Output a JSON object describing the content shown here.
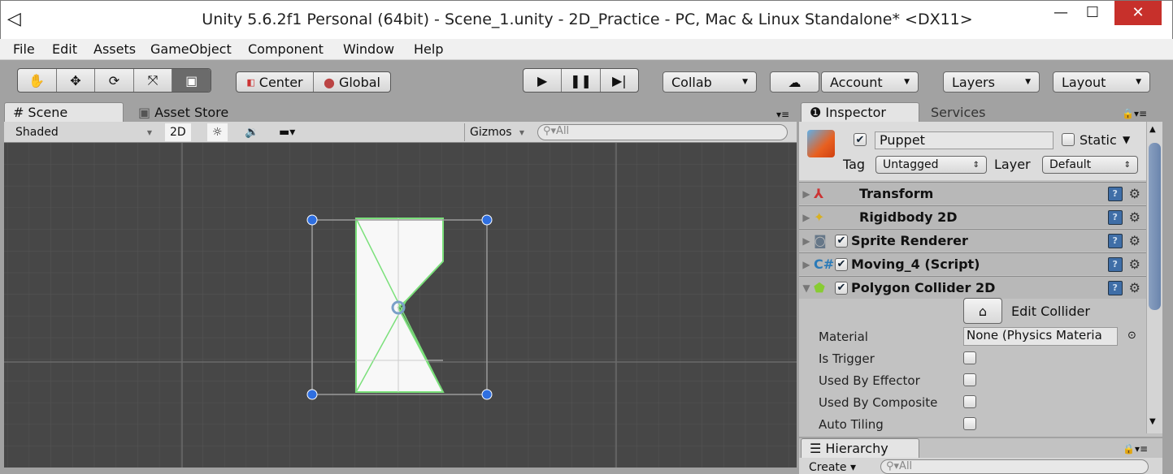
{
  "window": {
    "title": "Unity 5.6.2f1 Personal (64bit) - Scene_1.unity - 2D_Practice - PC, Mac & Linux Standalone* <DX11>",
    "minimize": "—",
    "maximize": "☐",
    "close": "✕"
  },
  "menu": [
    "File",
    "Edit",
    "Assets",
    "GameObject",
    "Component",
    "Window",
    "Help"
  ],
  "toolbar": {
    "center": "Center",
    "global": "Global",
    "collab": "Collab",
    "account": "Account",
    "layers": "Layers",
    "layout": "Layout"
  },
  "tabs": {
    "scene": "Scene",
    "asset_store": "Asset Store",
    "inspector": "Inspector",
    "services": "Services",
    "hierarchy": "Hierarchy"
  },
  "scene_toolbar": {
    "shading": "Shaded",
    "mode2d": "2D",
    "gizmos": "Gizmos",
    "search_placeholder": "All"
  },
  "inspector": {
    "object_name": "Puppet",
    "static_label": "Static",
    "tag_label": "Tag",
    "tag": "Untagged",
    "layer_label": "Layer",
    "layer": "Default",
    "components": [
      {
        "name": "Transform",
        "enabled": null
      },
      {
        "name": "Rigidbody 2D",
        "enabled": null
      },
      {
        "name": "Sprite Renderer",
        "enabled": true
      },
      {
        "name": "Moving_4 (Script)",
        "enabled": true
      },
      {
        "name": "Polygon Collider 2D",
        "enabled": true
      }
    ],
    "edit_collider": "Edit Collider",
    "material_label": "Material",
    "material_value": "None (Physics Materia",
    "props": [
      {
        "label": "Is Trigger",
        "checked": false
      },
      {
        "label": "Used By Effector",
        "checked": false
      },
      {
        "label": "Used By Composite",
        "checked": false
      },
      {
        "label": "Auto Tiling",
        "checked": false
      }
    ]
  },
  "hierarchy": {
    "create": "Create",
    "search_placeholder": "All"
  }
}
